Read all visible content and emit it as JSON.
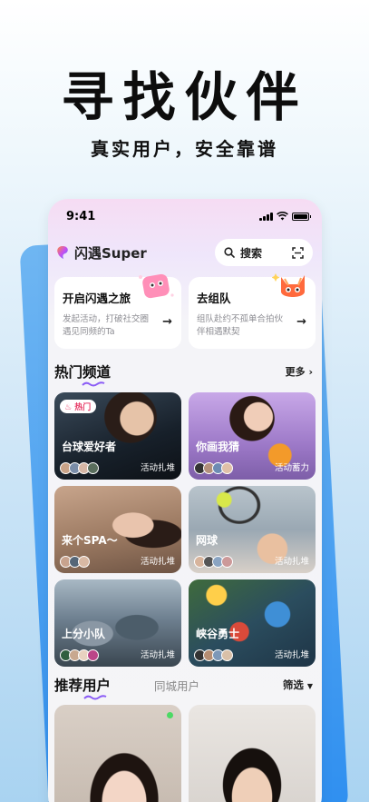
{
  "promo": {
    "headline": "寻找伙伴",
    "tagline": "真实用户，安全靠谱"
  },
  "status_bar": {
    "time": "9:41"
  },
  "app_bar": {
    "title": "闪遇Super",
    "search_label": "搜索"
  },
  "feature_cards": [
    {
      "title": "开启闪遇之旅",
      "desc": "发起活动，打破社交圈遇见同频的Ta"
    },
    {
      "title": "去组队",
      "desc": "组队赴约不孤单合拍伙伴相遇默契"
    }
  ],
  "hot_channels": {
    "title": "热门频道",
    "more_label": "更多",
    "hot_badge": "热门",
    "items": [
      {
        "name": "台球爱好者",
        "activity": "活动扎堆"
      },
      {
        "name": "你画我猜",
        "activity": "活动蓄力"
      },
      {
        "name": "来个SPA～",
        "activity": "活动扎堆"
      },
      {
        "name": "网球",
        "activity": "活动扎堆"
      },
      {
        "name": "上分小队",
        "activity": "活动扎堆"
      },
      {
        "name": "峡谷勇士",
        "activity": "活动扎堆"
      }
    ]
  },
  "recommend": {
    "title": "推荐用户",
    "tab_nearby": "同城用户",
    "filter_label": "筛选"
  },
  "colors": {
    "accent_purple": "#8b5cf6",
    "hot_red": "#e8406b",
    "online_green": "#4cd964",
    "brand_blue": "#2f8ff0"
  }
}
